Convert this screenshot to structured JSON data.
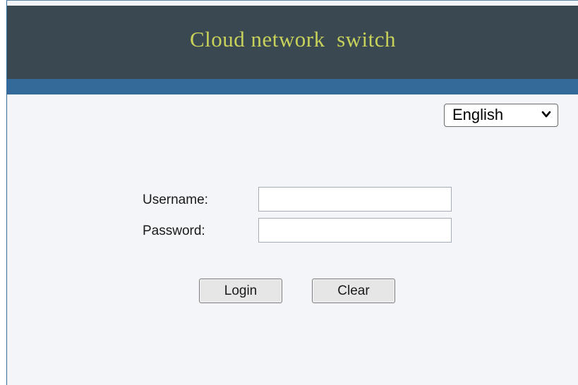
{
  "header": {
    "title": "Cloud network  switch"
  },
  "language_select": {
    "selected": "English",
    "icon": "chevron-down-icon"
  },
  "login_form": {
    "username_label": "Username:",
    "username_value": "",
    "password_label": "Password:",
    "password_value": "",
    "login_button": "Login",
    "clear_button": "Clear"
  },
  "colors": {
    "header_bg": "#3a4852",
    "header_title": "#c8d25a",
    "stripe": "#336a99",
    "page_bg": "#f4f5f8"
  }
}
